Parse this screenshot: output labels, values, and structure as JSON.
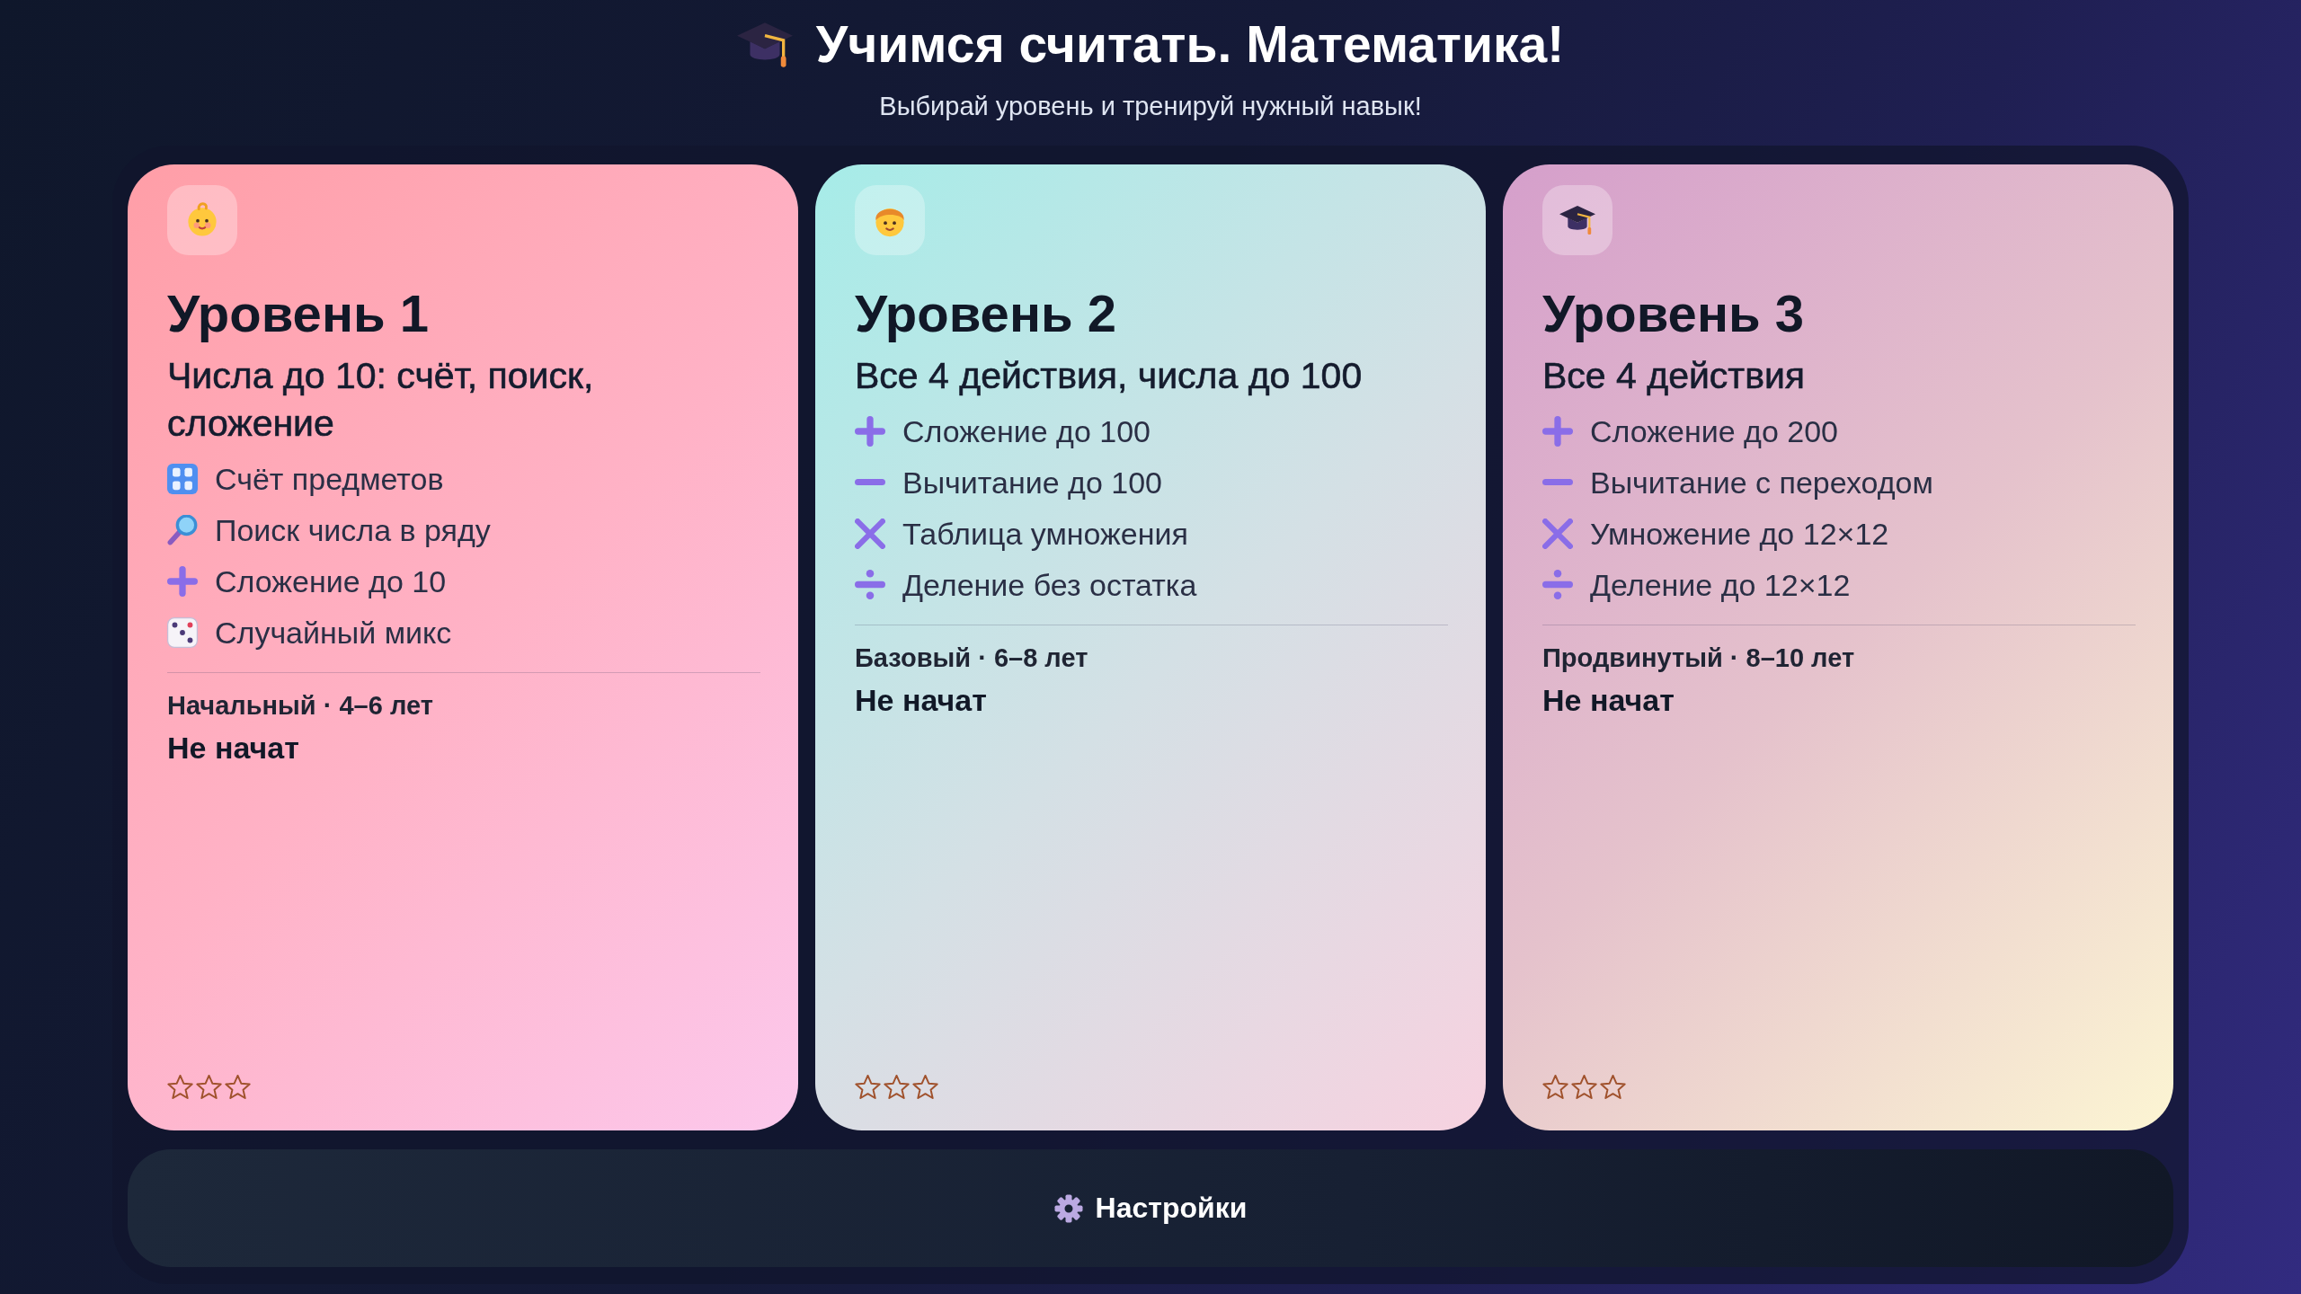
{
  "header": {
    "title": "Учимся считать. Математика!",
    "subtitle": "Выбирай уровень и тренируй нужный навык!"
  },
  "levels": [
    {
      "kind": "beginner",
      "title": "Уровень 1",
      "subtitle": "Числа до 10: счёт, поиск, сложение",
      "skills": [
        {
          "kind": "count",
          "label": "Счёт предметов"
        },
        {
          "kind": "search",
          "label": "Поиск числа в ряду"
        },
        {
          "kind": "add",
          "label": "Сложение до 10"
        },
        {
          "kind": "random",
          "label": "Случайный микс"
        }
      ],
      "meta": "Начальный · 4–6 лет",
      "status": "Не начат",
      "stars": 0
    },
    {
      "kind": "basic",
      "title": "Уровень 2",
      "subtitle": "Все 4 действия, числа до 100",
      "skills": [
        {
          "kind": "add",
          "label": "Сложение до 100"
        },
        {
          "kind": "subtract",
          "label": "Вычитание до 100"
        },
        {
          "kind": "multiply",
          "label": "Таблица умножения"
        },
        {
          "kind": "divide",
          "label": "Деление без остатка"
        }
      ],
      "meta": "Базовый · 6–8 лет",
      "status": "Не начат",
      "stars": 0
    },
    {
      "kind": "advanced",
      "title": "Уровень 3",
      "subtitle": "Все 4 действия",
      "skills": [
        {
          "kind": "add",
          "label": "Сложение до 200"
        },
        {
          "kind": "subtract",
          "label": "Вычитание с переходом"
        },
        {
          "kind": "multiply",
          "label": "Умножение до 12×12"
        },
        {
          "kind": "divide",
          "label": "Деление до 12×12"
        }
      ],
      "meta": "Продвинутый · 8–10 лет",
      "status": "Не начат",
      "stars": 0
    }
  ],
  "settings_button": {
    "label": "Настройки"
  }
}
